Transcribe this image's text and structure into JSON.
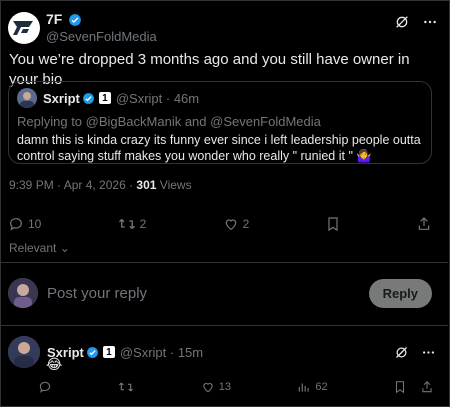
{
  "main_tweet": {
    "author_name": "7F",
    "author_handle": "@SevenFoldMedia",
    "text": "You we’re dropped 3 months ago and you still have owner in your bio",
    "time": "9:39 PM · Apr 4, 2026 ·",
    "views_count": "301",
    "views_label": "Views",
    "stats": {
      "replies": "10",
      "reposts": "2",
      "likes": "2"
    }
  },
  "quoted_tweet": {
    "author_name": "Sxript",
    "badge": "1",
    "author_handle": "@Sxript · 46m",
    "replying_to": "Replying to @BigBackManik and @SevenFoldMedia",
    "text": "damn this is kinda crazy its funny ever since i left leadership people outta control saying stuff makes you wonder who really \" runied it \" 🤷‍♀️"
  },
  "sort": {
    "label": "Relevant"
  },
  "reply_box": {
    "placeholder": "Post your reply",
    "button_label": "Reply"
  },
  "reply_tweet": {
    "author_name": "Sxript",
    "badge": "1",
    "author_handle": "@Sxript · 15m",
    "text": "😂",
    "stats": {
      "likes": "13",
      "views": "62"
    }
  },
  "colors": {
    "background": "#000000",
    "verified": "#1d9bf0",
    "muted": "#71767b"
  }
}
